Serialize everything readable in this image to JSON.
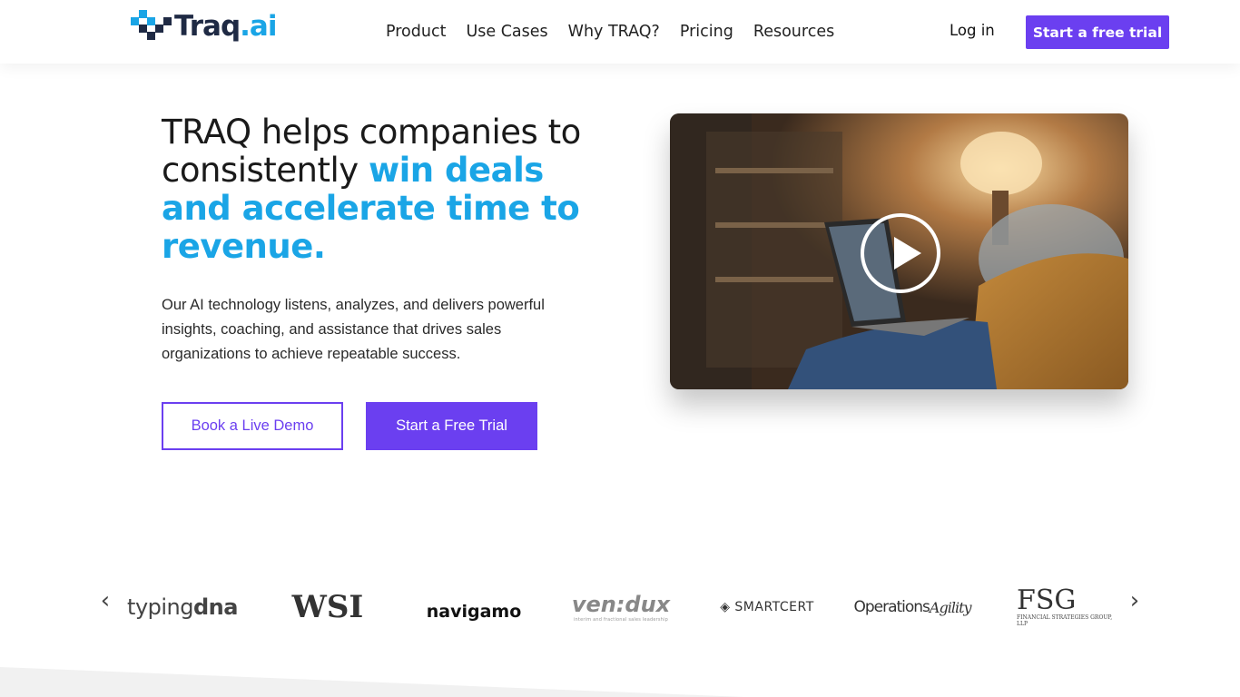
{
  "header": {
    "logo": {
      "text_main": "Traq",
      "text_dot": ".ai"
    },
    "nav": [
      {
        "label": "Product"
      },
      {
        "label": "Use Cases"
      },
      {
        "label": "Why TRAQ?"
      },
      {
        "label": "Pricing"
      },
      {
        "label": "Resources"
      }
    ],
    "login_label": "Log in",
    "cta_label": "Start a free trial"
  },
  "hero": {
    "headline_plain": "TRAQ helps companies to consistently ",
    "headline_highlight": "win deals and accelerate time to revenue.",
    "subtext": "Our AI technology listens, analyzes, and delivers powerful insights, coaching, and assistance that drives sales organizations to achieve repeatable success.",
    "demo_button": "Book a Live Demo",
    "trial_button": "Start a Free Trial",
    "video_play_icon": "play-icon"
  },
  "logos": {
    "prev_icon": "chevron-left-icon",
    "next_icon": "chevron-right-icon",
    "prev_glyph": "‹",
    "next_glyph": "›",
    "items": [
      {
        "a": "typing",
        "b": "dna"
      },
      {
        "text": "WSI"
      },
      {
        "text": "navigamo"
      },
      {
        "text": "ven:dux",
        "small": "interim and fractional sales leadership"
      },
      {
        "text": "◈ SMARTCERT"
      },
      {
        "a": "Operations",
        "b": "Agility"
      },
      {
        "text": "FSG",
        "small": "FINANCIAL STRATEGIES GROUP, LLP"
      }
    ]
  },
  "colors": {
    "accent": "#6b3ff0",
    "highlight": "#1aa5e6",
    "logo_dark": "#1f2a44"
  }
}
